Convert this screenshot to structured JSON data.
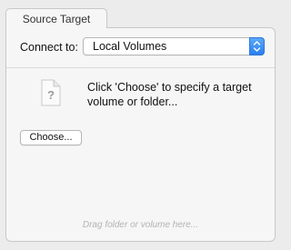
{
  "tab": {
    "label": "Source Target"
  },
  "connect": {
    "label": "Connect to:",
    "selected_value": "Local Volumes"
  },
  "content": {
    "instruction": "Click 'Choose' to specify a target volume or folder...",
    "choose_button_label": "Choose...",
    "drop_hint": "Drag folder or volume here..."
  },
  "icons": {
    "file": "unknown-file-icon",
    "stepper": "up-down-chevron-icon"
  },
  "colors": {
    "accent": "#2a7ff0",
    "background": "#ececec",
    "panel": "#f6f6f6"
  }
}
